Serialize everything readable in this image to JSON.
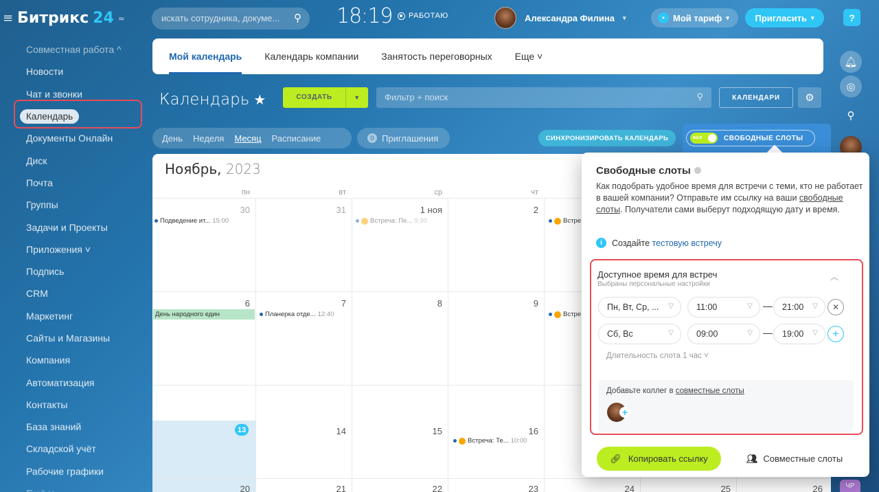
{
  "header": {
    "logo_word": "Битрикс",
    "logo_num": "24",
    "search_placeholder": "искать сотрудника, докуме...",
    "time": "18:19",
    "status": "РАБОТАЮ",
    "user_name": "Александра Филина",
    "tariff_label": "Мой тариф",
    "invite_label": "Пригласить",
    "help_label": "?"
  },
  "sidebar": {
    "items": [
      {
        "label": "Совместная работа ^",
        "kind": "group"
      },
      {
        "label": "Новости"
      },
      {
        "label": "Чат и звонки"
      },
      {
        "label": "Календарь",
        "active": true
      },
      {
        "label": "Документы Онлайн"
      },
      {
        "label": "Диск"
      },
      {
        "label": "Почта"
      },
      {
        "label": "Группы"
      },
      {
        "label": "Задачи и Проекты"
      },
      {
        "label": "Приложения ˅"
      },
      {
        "label": "Подпись"
      },
      {
        "label": "CRM"
      },
      {
        "label": "Маркетинг"
      },
      {
        "label": "Сайты и Магазины"
      },
      {
        "label": "Компания"
      },
      {
        "label": "Автоматизация"
      },
      {
        "label": "Контакты"
      },
      {
        "label": "База знаний"
      },
      {
        "label": "Складской учёт"
      },
      {
        "label": "Рабочие графики"
      },
      {
        "label": "Ещё ˅"
      }
    ]
  },
  "tabs": [
    "Мой календарь",
    "Календарь компании",
    "Занятость переговорных",
    "Еще ˅"
  ],
  "toolbar": {
    "title": "Календарь",
    "create_label": "СОЗДАТЬ",
    "filter_placeholder": "Фильтр + поиск",
    "calendars_label": "КАЛЕНДАРИ"
  },
  "views": {
    "items": [
      "День",
      "Неделя",
      "Месяц",
      "Расписание"
    ],
    "active": "Месяц",
    "invites_count": "0",
    "invites_label": "Приглашения",
    "sync_label": "СИНХРОНИЗИРОВАТЬ КАЛЕНДАРЬ",
    "slots_toggle": "вкл",
    "slots_label": "СВОБОДНЫЕ СЛОТЫ"
  },
  "calendar": {
    "month": "Ноябрь,",
    "year": "2023",
    "weekdays": [
      "пн",
      "вт",
      "ср",
      "чт"
    ],
    "rows": [
      [
        "30",
        "31",
        "1 ноя",
        "2"
      ],
      [
        "6",
        "7",
        "8",
        "9"
      ],
      [
        "13",
        "14",
        "15",
        "16"
      ],
      [
        "20",
        "21",
        "22",
        "23",
        "24",
        "25",
        "26"
      ]
    ],
    "events": {
      "e1": {
        "title": "Подведение ит...",
        "time": "15:00"
      },
      "e2": {
        "title": "Встреча: Пе...",
        "time": "9:30"
      },
      "e3": {
        "title": "Встре"
      },
      "e4": {
        "title": "День народного един"
      },
      "e5": {
        "title": "Планерка отде...",
        "time": "12:40"
      },
      "e6": {
        "title": "Встре"
      },
      "e7": {
        "title": "Встреча: Те...",
        "time": "10:00"
      }
    }
  },
  "rightbar": {
    "chat_badge": "ЧР"
  },
  "popup": {
    "title": "Свободные слоты",
    "desc_1": "Как подобрать удобное время для встречи с теми, кто не работает в вашей компании? Отправьте им ссылку на ваши ",
    "desc_link": "свободные слоты",
    "desc_2": ". Получатели сами выберут подходящую дату и время.",
    "info_text": "Создайте ",
    "info_link": "тестовую встречу",
    "avail_title": "Доступное время для встреч",
    "avail_sub": "Выбраны персональные настройки",
    "rule1": {
      "days": "Пн, Вт, Ср, ...",
      "from": "11:00",
      "to": "21:00"
    },
    "rule2": {
      "days": "Сб, Вс",
      "from": "09:00",
      "to": "19:00"
    },
    "duration": "Длительность слота 1 час ˅",
    "colleagues_text": "Добавьте коллег в ",
    "colleagues_link": "совместные слоты",
    "copy_label": "Копировать ссылку",
    "joint_label": "Совместные слоты"
  }
}
